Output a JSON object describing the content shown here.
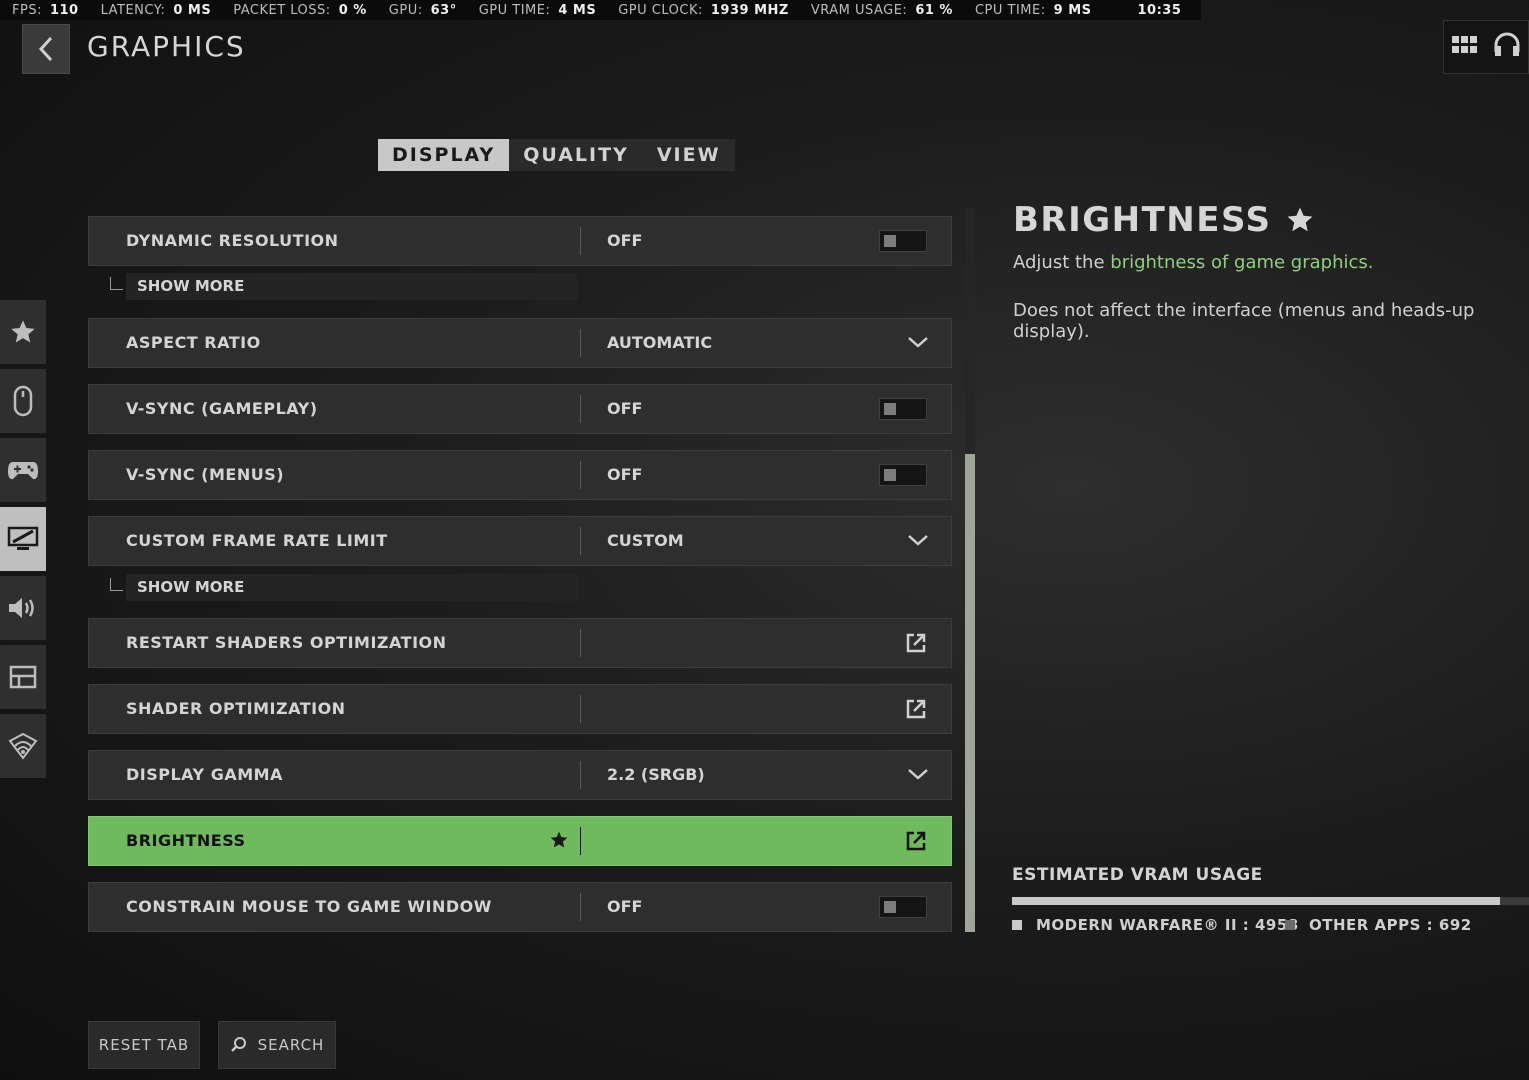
{
  "stats": [
    {
      "key": "FPS:",
      "value": "110"
    },
    {
      "key": "LATENCY:",
      "value": "0 MS"
    },
    {
      "key": "PACKET LOSS:",
      "value": "0 %"
    },
    {
      "key": "GPU:",
      "value": "63°"
    },
    {
      "key": "GPU TIME:",
      "value": "4 MS"
    },
    {
      "key": "GPU CLOCK:",
      "value": "1939 MHZ"
    },
    {
      "key": "VRAM USAGE:",
      "value": "61 %"
    },
    {
      "key": "CPU TIME:",
      "value": "9 MS"
    }
  ],
  "clock": "10:35",
  "header": {
    "title": "GRAPHICS"
  },
  "tabs": [
    {
      "label": "DISPLAY",
      "active": true
    },
    {
      "label": "QUALITY",
      "active": false
    },
    {
      "label": "VIEW",
      "active": false
    }
  ],
  "sidebar": [
    "star-icon",
    "mouse-icon",
    "gamepad-icon",
    "monitor-icon",
    "speaker-icon",
    "interface-icon",
    "network-icon"
  ],
  "settings": [
    {
      "label": "DYNAMIC RESOLUTION",
      "value": "OFF",
      "control": "toggle"
    },
    {
      "label": "ASPECT RATIO",
      "value": "AUTOMATIC",
      "control": "dropdown"
    },
    {
      "label": "V-SYNC (GAMEPLAY)",
      "value": "OFF",
      "control": "toggle"
    },
    {
      "label": "V-SYNC (MENUS)",
      "value": "OFF",
      "control": "toggle"
    },
    {
      "label": "CUSTOM FRAME RATE LIMIT",
      "value": "CUSTOM",
      "control": "dropdown"
    },
    {
      "label": "RESTART SHADERS OPTIMIZATION",
      "value": "",
      "control": "external"
    },
    {
      "label": "SHADER OPTIMIZATION",
      "value": "",
      "control": "external"
    },
    {
      "label": "DISPLAY GAMMA",
      "value": "2.2 (SRGB)",
      "control": "dropdown"
    },
    {
      "label": "BRIGHTNESS",
      "value": "",
      "control": "external",
      "selected": true,
      "favorite": true
    },
    {
      "label": "CONSTRAIN MOUSE TO GAME WINDOW",
      "value": "OFF",
      "control": "toggle"
    }
  ],
  "show_more_label": "SHOW MORE",
  "detail": {
    "title": "BRIGHTNESS",
    "line1_prefix": "Adjust the ",
    "line1_highlight": "brightness of game graphics.",
    "line2": "Does not affect the interface (menus and heads-up display)."
  },
  "vram": {
    "title": "ESTIMATED VRAM USAGE",
    "used_fraction": 0.943,
    "items": [
      {
        "label": "MODERN WARFARE® II : 4958",
        "color": "#c9c9c9"
      },
      {
        "label": "OTHER APPS : 692",
        "color": "#6a6a6a"
      }
    ]
  },
  "buttons": {
    "reset": "RESET TAB",
    "search": "SEARCH"
  },
  "colors": {
    "accent": "#6fba5c",
    "highlight_text": "#8fd07a"
  }
}
